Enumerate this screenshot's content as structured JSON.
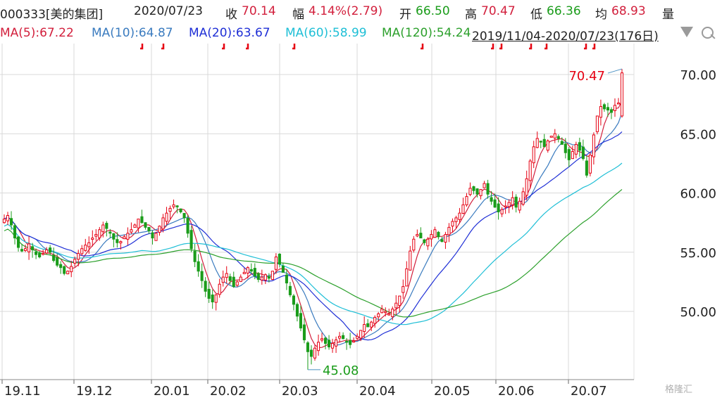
{
  "header": {
    "code_name": "000333[美的集团]",
    "date": "2020/07/23",
    "close_label": "收",
    "close_value": "70.14",
    "change_label": "幅",
    "change_value": "4.14%(2.79)",
    "open_label": "开",
    "open_value": "66.50",
    "high_label": "高",
    "high_value": "70.47",
    "low_label": "低",
    "low_value": "66.36",
    "avg_label": "均",
    "avg_value": "68.93",
    "volume_label": "量"
  },
  "ma_row": {
    "ma5": "MA(5):67.22",
    "ma10": "MA(10):64.87",
    "ma20": "MA(20):63.67",
    "ma60": "MA(60):58.99",
    "ma120": "MA(120):54.24",
    "range": "2019/11/04-2020/07/23(176日)"
  },
  "colors": {
    "up": "#e60012",
    "down": "#1a9c1a",
    "ma5": "#d21f3c",
    "ma10": "#3a7bbf",
    "ma20": "#1f2fd6",
    "ma60": "#1fbfd6",
    "ma120": "#2ca02c",
    "grid": "#d9d9d9"
  },
  "watermark": "格隆汇",
  "chart_data": {
    "type": "candlestick",
    "title": "",
    "x_ticks": [
      "19.11",
      "19.12",
      "20.01",
      "20.02",
      "20.03",
      "20.04",
      "20.05",
      "20.06",
      "20.07"
    ],
    "ylim": [
      45.08,
      70.47
    ],
    "y_ticks": [
      "50.00",
      "55.00",
      "60.00",
      "65.00",
      "70.00"
    ],
    "grid": true,
    "annotations": [
      {
        "text": "70.47",
        "label": "high"
      },
      {
        "text": "45.08",
        "label": "low"
      }
    ],
    "approximate_closes": [
      57.8,
      58.1,
      57.3,
      56.2,
      55.4,
      55.1,
      55.3,
      55.7,
      55.2,
      54.8,
      54.6,
      54.9,
      55.2,
      55.0,
      54.3,
      53.9,
      53.7,
      53.2,
      53.4,
      53.8,
      54.4,
      54.9,
      55.3,
      55.6,
      55.8,
      56.2,
      56.5,
      56.9,
      57.3,
      57.0,
      56.6,
      56.1,
      55.8,
      55.9,
      56.3,
      56.6,
      56.9,
      57.3,
      57.8,
      57.5,
      57.1,
      56.8,
      56.2,
      56.6,
      57.2,
      57.9,
      58.3,
      58.7,
      59.0,
      58.9,
      58.4,
      57.9,
      56.6,
      55.3,
      54.2,
      53.4,
      52.6,
      51.7,
      51.1,
      50.8,
      51.4,
      52.3,
      52.9,
      53.2,
      52.6,
      52.1,
      52.5,
      52.9,
      53.3,
      53.7,
      53.4,
      53.0,
      52.7,
      52.9,
      53.1,
      52.8,
      53.4,
      54.6,
      54.0,
      53.3,
      52.4,
      51.4,
      50.6,
      49.6,
      48.6,
      47.6,
      46.6,
      46.2,
      46.9,
      47.4,
      47.7,
      47.3,
      47.0,
      47.3,
      47.6,
      47.9,
      47.7,
      47.4,
      47.2,
      47.5,
      47.9,
      48.4,
      48.9,
      48.7,
      49.1,
      49.5,
      49.8,
      50.2,
      50.0,
      49.8,
      50.2,
      50.7,
      51.3,
      52.1,
      53.6,
      55.1,
      56.1,
      56.5,
      56.2,
      55.8,
      56.1,
      56.5,
      56.9,
      56.3,
      55.9,
      56.5,
      57.1,
      57.6,
      57.9,
      58.3,
      59.0,
      59.7,
      60.4,
      60.2,
      59.9,
      60.3,
      60.8,
      59.9,
      59.3,
      58.8,
      58.4,
      58.6,
      58.9,
      59.2,
      59.6,
      58.8,
      59.3,
      60.1,
      61.2,
      62.7,
      63.9,
      64.6,
      64.3,
      63.9,
      64.4,
      64.8,
      65.0,
      64.6,
      64.1,
      63.4,
      62.8,
      63.5,
      64.1,
      63.6,
      62.9,
      61.5,
      63.2,
      64.9,
      66.5,
      67.3,
      67.1,
      67.0,
      66.8,
      67.4,
      67.6,
      70.14
    ]
  }
}
